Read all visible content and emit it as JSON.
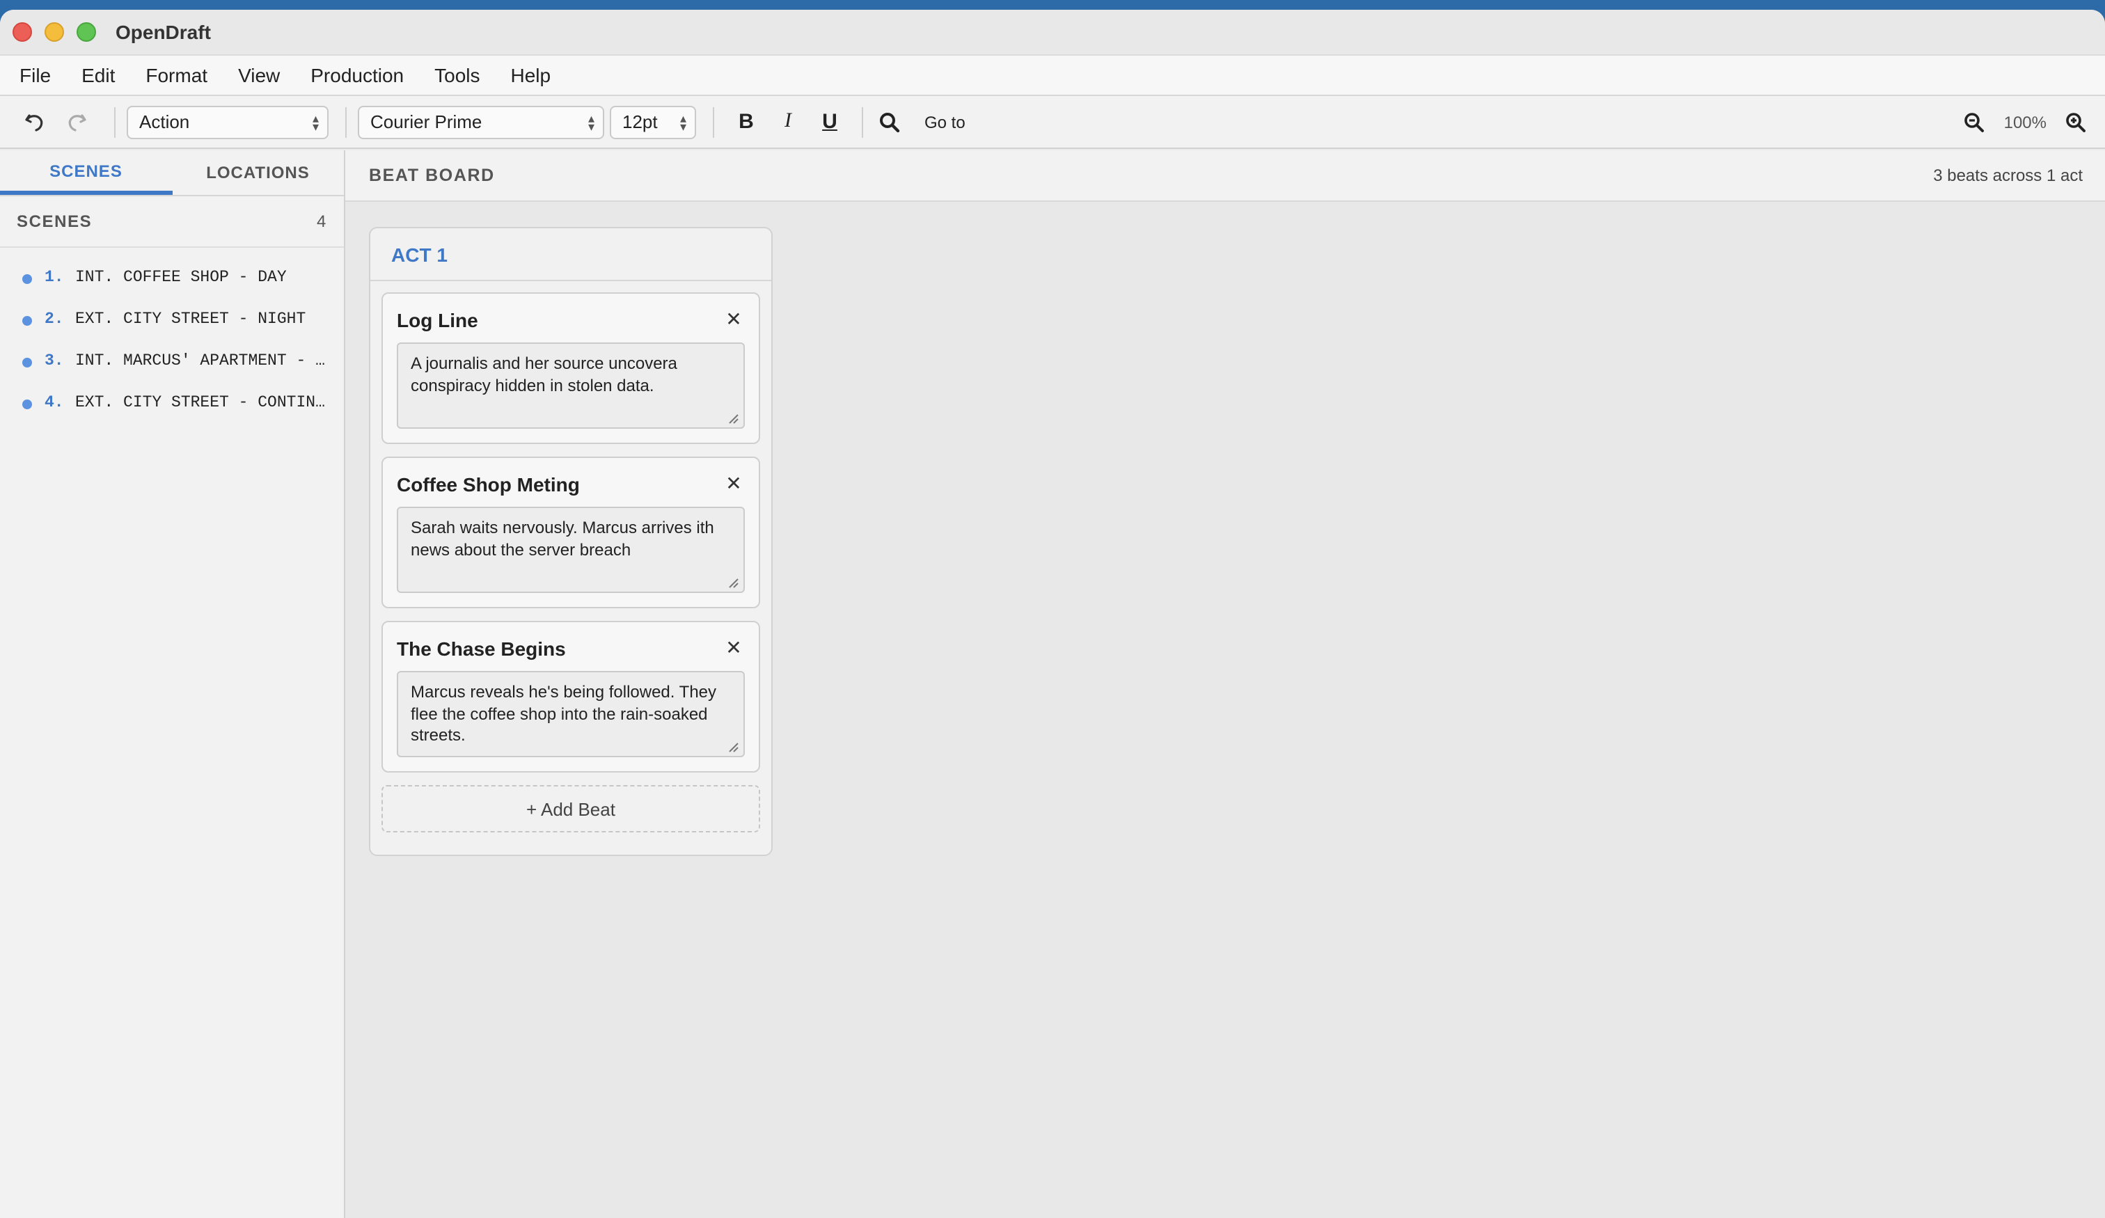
{
  "app": {
    "title": "OpenDraft"
  },
  "menu": [
    "File",
    "Edit",
    "Format",
    "View",
    "Production",
    "Tools",
    "Help"
  ],
  "toolbar": {
    "element_type": "Action",
    "font": "Courier Prime",
    "size": "12pt",
    "bold": "B",
    "italic": "I",
    "underline": "U",
    "goto_label": "Go to",
    "zoom": "100%"
  },
  "sidebar": {
    "tabs": [
      {
        "label": "SCENES",
        "active": true
      },
      {
        "label": "LOCATIONS",
        "active": false
      }
    ],
    "header": "SCENES",
    "count": "4",
    "scenes": [
      {
        "num": "1.",
        "slug": "INT. COFFEE SHOP - DAY"
      },
      {
        "num": "2.",
        "slug": "EXT. CITY STREET - NIGHT"
      },
      {
        "num": "3.",
        "slug": "INT. MARCUS' APARTMENT - NIGHT"
      },
      {
        "num": "4.",
        "slug": "EXT. CITY STREET - CONTINUOUS"
      }
    ]
  },
  "board": {
    "title": "BEAT BOARD",
    "meta": "3 beats across 1 act",
    "act": "ACT 1",
    "beats": [
      {
        "title": "Log Line",
        "desc": "A journalis and her source uncovera conspiracy hidden in stolen data."
      },
      {
        "title": "Coffee Shop Meting",
        "desc": "Sarah waits nervously. Marcus arrives ith news about the server breach"
      },
      {
        "title": "The Chase Begins",
        "desc": "Marcus reveals he's being followed. They flee the coffee shop into the rain-soaked streets."
      }
    ],
    "add_label": "+ Add Beat",
    "close_glyph": "✕"
  },
  "colors": {
    "accent": "#3e78c7",
    "dot": "#5b93e0"
  }
}
